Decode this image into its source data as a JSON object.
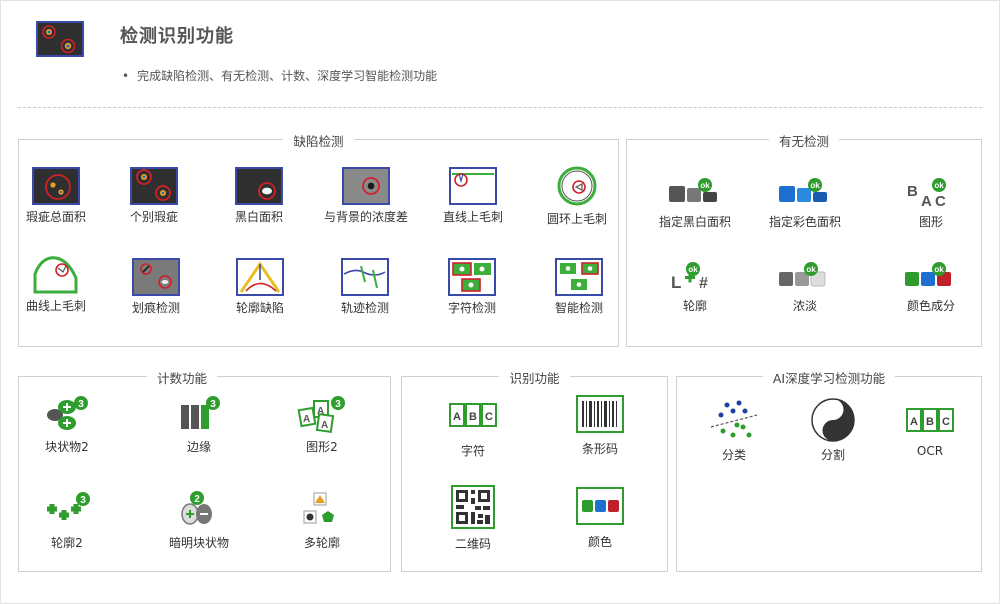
{
  "header": {
    "title": "检测识别功能",
    "bullet": "完成缺陷检测、有无检测、计数、深度学习智能检测功能",
    "bullet_dot": "•"
  },
  "panels": {
    "defect": {
      "title": "缺陷检测",
      "items": [
        "瑕疵总面积",
        "个别瑕疵",
        "黑白面积",
        "与背景的浓度差",
        "直线上毛刺",
        "圆环上毛刺",
        "曲线上毛刺",
        "划痕检测",
        "轮廓缺陷",
        "轨迹检测",
        "字符检测",
        "智能检测"
      ]
    },
    "presence": {
      "title": "有无检测",
      "items": [
        "指定黑白面积",
        "指定彩色面积",
        "图形",
        "轮廓",
        "浓淡",
        "颜色成分"
      ]
    },
    "count": {
      "title": "计数功能",
      "items": [
        "块状物2",
        "边缘",
        "图形2",
        "轮廓2",
        "暗明块状物",
        "多轮廓"
      ]
    },
    "recog": {
      "title": "识别功能",
      "items": [
        "字符",
        "条形码",
        "二维码",
        "颜色"
      ]
    },
    "ai": {
      "title": "AI深度学习检测功能",
      "items": [
        "分类",
        "分割",
        "OCR"
      ]
    }
  },
  "icon_text": {
    "ok": "ok",
    "n3": "3",
    "n2": "2",
    "abc": [
      "A",
      "B",
      "C"
    ],
    "bac": [
      "B",
      "A",
      "C"
    ],
    "lh": [
      "L",
      "#"
    ]
  },
  "colors": {
    "dark_panel": "#2f2f2f",
    "blue_frame": "#3a4aa8",
    "red_ring": "#d0202a",
    "green": "#3cae3c",
    "ok_green": "#2e9d2e"
  }
}
